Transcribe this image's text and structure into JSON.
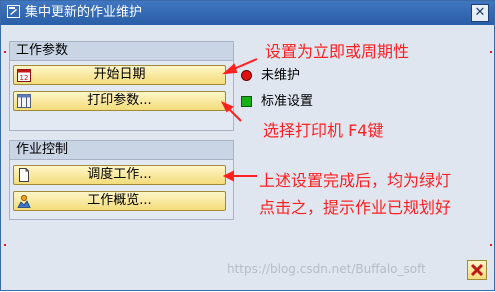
{
  "window": {
    "title": "集中更新的作业维护",
    "title_icon": "dialog-icon",
    "close_label": "✕"
  },
  "job_params": {
    "header": "工作参数",
    "start_date_button": "开始日期",
    "print_params_button": "打印参数..."
  },
  "status": {
    "not_maintained": "未维护",
    "standard_settings": "标准设置",
    "not_maintained_color": "#e01010",
    "standard_color": "#18b018"
  },
  "job_control": {
    "header": "作业控制",
    "schedule_button": "调度工作...",
    "overview_button": "工作概览..."
  },
  "annotations": {
    "a1": "设置为立即或周期性",
    "a2": "选择打印机 F4键",
    "a3_line1": "上述设置完成后，均为绿灯",
    "a3_line2": "点击之，提示作业已规划好"
  },
  "watermark": "https://blog.csdn.net/Buffalo_soft"
}
